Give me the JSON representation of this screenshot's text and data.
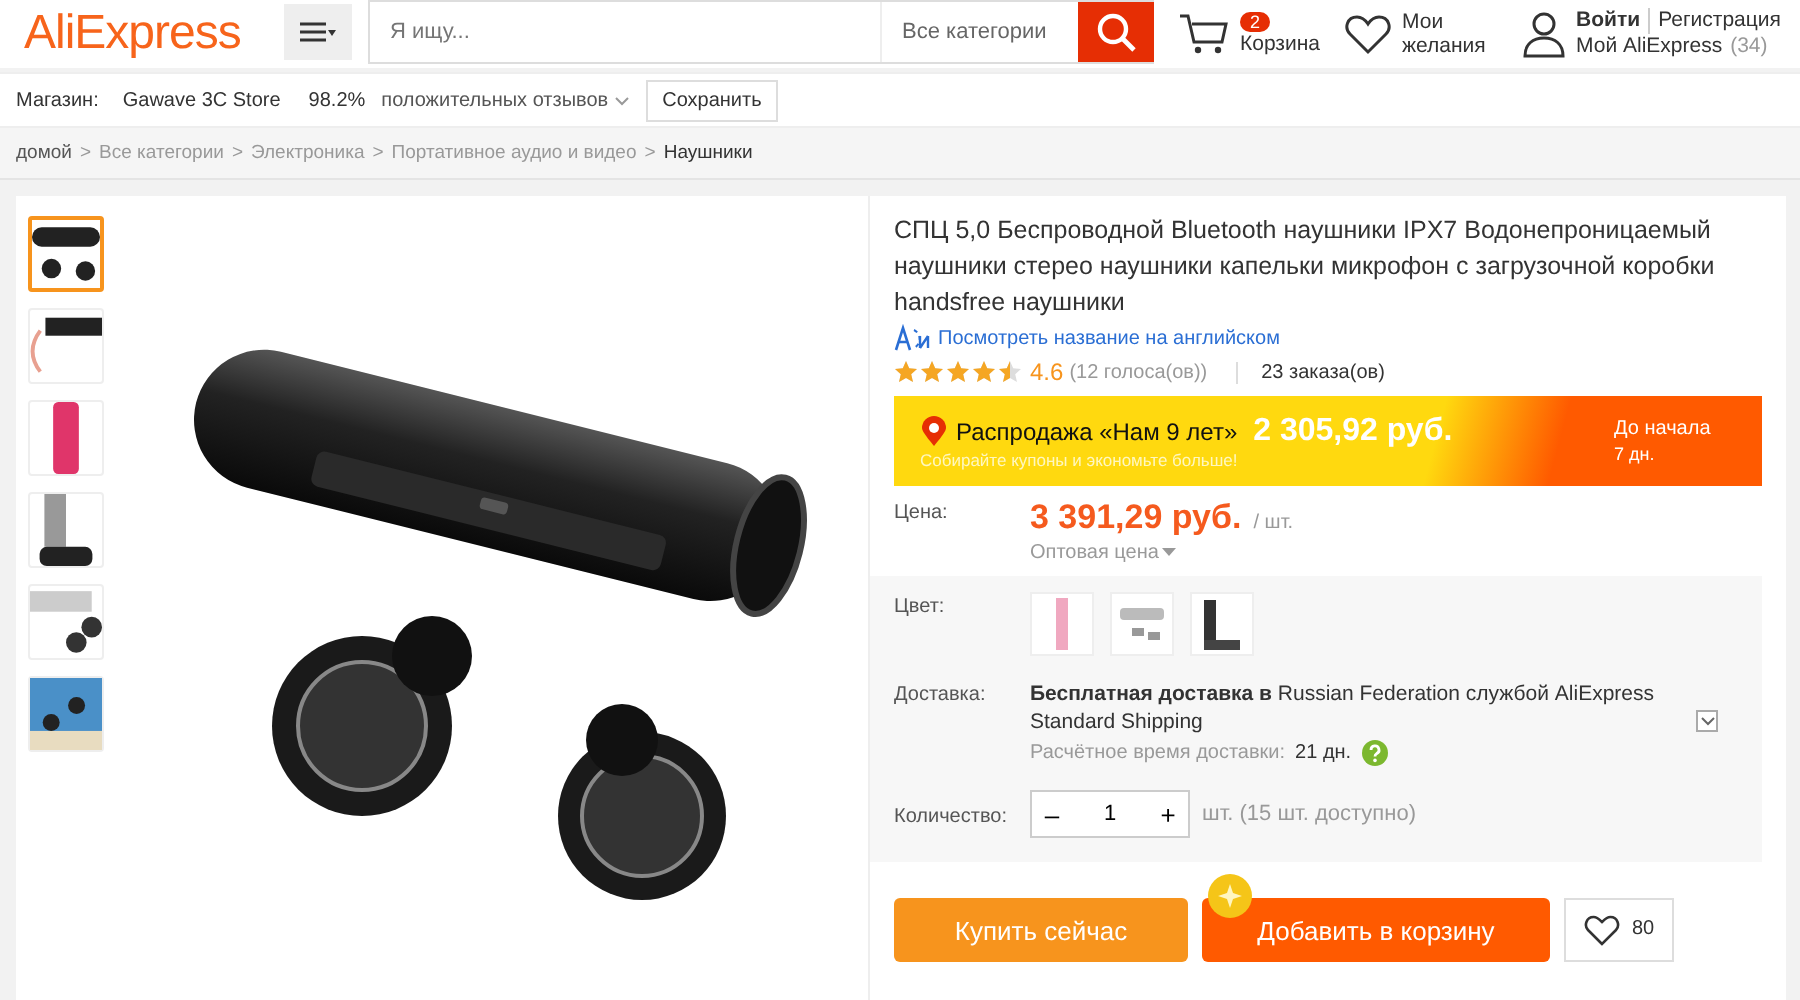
{
  "header": {
    "logo": "AliExpress",
    "search": {
      "placeholder": "Я ищу..."
    },
    "category": "Все категории",
    "cart": {
      "count": "2",
      "label": "Корзина"
    },
    "wishlist": {
      "label": "Мои желания"
    },
    "account": {
      "login": "Войти",
      "register": "Регистрация",
      "label": "Мой AliExpress",
      "count": "(34)"
    }
  },
  "store_bar": {
    "label": "Магазин:",
    "store": "Gawave 3C Store",
    "rating": "98.2%",
    "rating_text": "положительных отзывов",
    "save": "Сохранить"
  },
  "breadcrumbs": [
    {
      "label": "домой",
      "current": false
    },
    {
      "separator": ">",
      "label": "Все категории",
      "current": false
    },
    {
      "separator": ">",
      "label": "Электроника",
      "current": false
    },
    {
      "separator": ">",
      "label": "Портативное аудио и видео",
      "current": false
    },
    {
      "separator": ">",
      "label": "Наушники",
      "current": true
    }
  ],
  "gallery": {
    "thumbnails": [
      {
        "selected": true
      },
      {
        "selected": false
      },
      {
        "selected": false
      },
      {
        "selected": false
      },
      {
        "selected": false
      },
      {
        "selected": false
      }
    ]
  },
  "product": {
    "title": "СПЦ 5,0 Беспроводной Bluetooth наушники IPX7 Водонепроницаемый наушники стерео наушники капельки микрофон с загрузочной коробки handsfree наушники",
    "translate_link": "Посмотреть название на английском",
    "stars": 4.5,
    "rating": "4.6",
    "votes": "(12 голоса(ов))",
    "orders": "23 заказа(ов)",
    "promo": {
      "title": "Распродажа «Нам 9 лет»",
      "price": "2 305,92 руб.",
      "subtitle": "Собирайте купоны и экономьте больше!",
      "countdown_label": "До начала",
      "countdown": "7 дн."
    },
    "price_label": "Цена:",
    "price": "3 391,29 руб.",
    "unit": "/ шт.",
    "wholesale": "Оптовая цена",
    "color_label": "Цвет:",
    "colors": [
      {
        "selected": false
      },
      {
        "selected": false
      },
      {
        "selected": false
      }
    ],
    "delivery_label": "Доставка:",
    "delivery": "**Бесплатная доставка в** Russian Federation службой AliExpress Standard Shipping",
    "delivery_time_label": "Расчётное время доставки:",
    "delivery_time": "21 дн.",
    "quantity_label": "Количество:",
    "quantity": "1",
    "minus": "–",
    "plus": "+",
    "availability": "шт. (15 шт. доступно)",
    "buy_button": "Купить сейчас",
    "cart_button": "Добавить в корзину",
    "wish_count": "80"
  }
}
